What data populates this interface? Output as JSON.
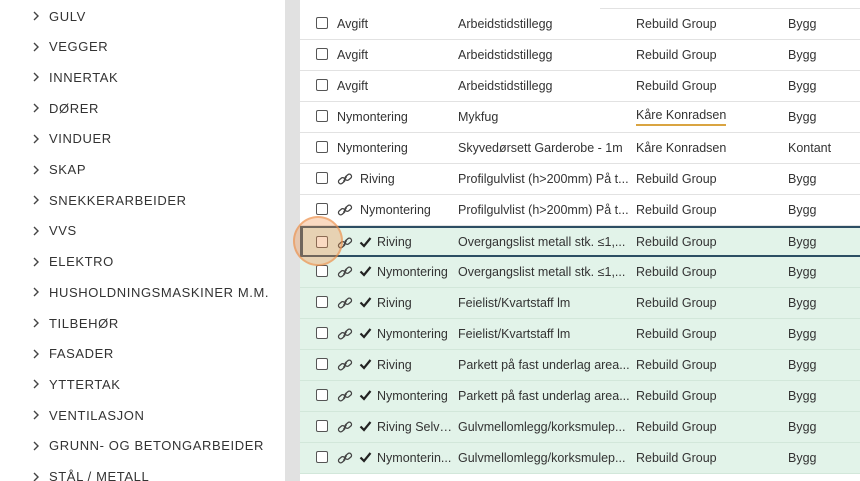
{
  "sidebar": {
    "items": [
      {
        "label": "GULV"
      },
      {
        "label": "VEGGER"
      },
      {
        "label": "INNERTAK"
      },
      {
        "label": "DØRER"
      },
      {
        "label": "VINDUER"
      },
      {
        "label": "SKAP"
      },
      {
        "label": "SNEKKERARBEIDER"
      },
      {
        "label": "VVS"
      },
      {
        "label": "ELEKTRO"
      },
      {
        "label": "HUSHOLDNINGSMASKINER M.M."
      },
      {
        "label": "TILBEHØR"
      },
      {
        "label": "FASADER"
      },
      {
        "label": "YTTERTAK"
      },
      {
        "label": "VENTILASJON"
      },
      {
        "label": "GRUNN- OG BETONGARBEIDER"
      },
      {
        "label": "STÅL / METALL"
      }
    ]
  },
  "table": {
    "rows": [
      {
        "type": "Avgift",
        "desc": "Arbeidstidstillegg",
        "supplier": "Rebuild Group",
        "category": "Bygg",
        "linked": false,
        "checked": false,
        "green": false
      },
      {
        "type": "Avgift",
        "desc": "Arbeidstidstillegg",
        "supplier": "Rebuild Group",
        "category": "Bygg",
        "linked": false,
        "checked": false,
        "green": false
      },
      {
        "type": "Avgift",
        "desc": "Arbeidstidstillegg",
        "supplier": "Rebuild Group",
        "category": "Bygg",
        "linked": false,
        "checked": false,
        "green": false
      },
      {
        "type": "Nymontering",
        "desc": "Mykfug",
        "supplier": "Kåre Konradsen",
        "category": "Bygg",
        "linked": false,
        "checked": false,
        "green": false
      },
      {
        "type": "Nymontering",
        "desc": "Skyvedørsett Garderobe - 1m",
        "supplier": "Kåre Konradsen",
        "category": "Kontant",
        "linked": false,
        "checked": false,
        "green": false
      },
      {
        "type": "Riving",
        "desc": "Profilgulvlist (h>200mm) På t...",
        "supplier": "Rebuild Group",
        "category": "Bygg",
        "linked": true,
        "checked": false,
        "green": false
      },
      {
        "type": "Nymontering",
        "desc": "Profilgulvlist (h>200mm) På t...",
        "supplier": "Rebuild Group",
        "category": "Bygg",
        "linked": true,
        "checked": false,
        "green": false
      },
      {
        "type": "Riving",
        "desc": "Overgangslist metall stk. ≤1,...",
        "supplier": "Rebuild Group",
        "category": "Bygg",
        "linked": true,
        "checked": true,
        "green": true
      },
      {
        "type": "Nymontering",
        "desc": "Overgangslist metall stk. ≤1,...",
        "supplier": "Rebuild Group",
        "category": "Bygg",
        "linked": true,
        "checked": true,
        "green": true
      },
      {
        "type": "Riving",
        "desc": "Feielist/Kvartstaff lm",
        "supplier": "Rebuild Group",
        "category": "Bygg",
        "linked": true,
        "checked": true,
        "green": true
      },
      {
        "type": "Nymontering",
        "desc": "Feielist/Kvartstaff lm",
        "supplier": "Rebuild Group",
        "category": "Bygg",
        "linked": true,
        "checked": true,
        "green": true
      },
      {
        "type": "Riving",
        "desc": "Parkett på fast underlag area...",
        "supplier": "Rebuild Group",
        "category": "Bygg",
        "linked": true,
        "checked": true,
        "green": true
      },
      {
        "type": "Nymontering",
        "desc": "Parkett på fast underlag area...",
        "supplier": "Rebuild Group",
        "category": "Bygg",
        "linked": true,
        "checked": true,
        "green": true
      },
      {
        "type": "Riving Selvk...",
        "desc": "Gulvmellomlegg/korksmulep...",
        "supplier": "Rebuild Group",
        "category": "Bygg",
        "linked": true,
        "checked": true,
        "green": true
      },
      {
        "type": "Nymonterin...",
        "desc": "Gulvmellomlegg/korksmulep...",
        "supplier": "Rebuild Group",
        "category": "Bygg",
        "linked": true,
        "checked": true,
        "green": true
      }
    ]
  },
  "colors": {
    "green_row": "#e2f3e9",
    "selection": "#2c4e63",
    "underline": "#d9a441",
    "click_marker": "#f0964f"
  }
}
